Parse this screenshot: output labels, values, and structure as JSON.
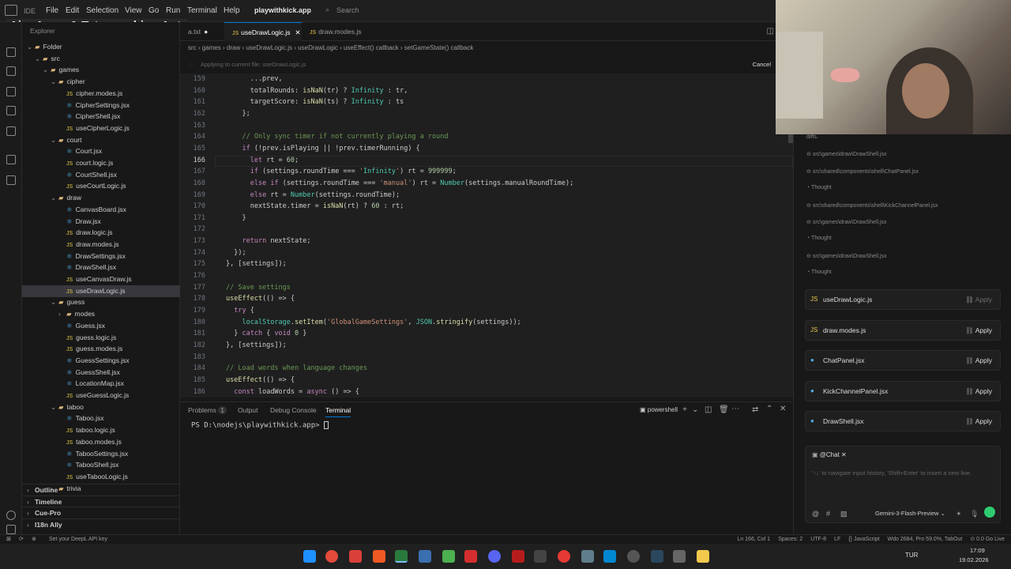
{
  "titlebar": {
    "brand": "IDE",
    "menus": [
      "File",
      "Edit",
      "Selection",
      "View",
      "Go",
      "Run",
      "Terminal",
      "Help"
    ],
    "project": "playwithkick.app",
    "search_placeholder": "Search"
  },
  "overlay_title": "Aira Arere & Tatsunoshin - Apt.",
  "sidebar": {
    "header": "Explorer",
    "tree": [
      {
        "label": "Folder",
        "level": 0,
        "kind": "folder",
        "open": true
      },
      {
        "label": "src",
        "level": 1,
        "kind": "folder",
        "open": true
      },
      {
        "label": "games",
        "level": 2,
        "kind": "folder",
        "open": true
      },
      {
        "label": "cipher",
        "level": 3,
        "kind": "folder",
        "open": true
      },
      {
        "label": "cipher.modes.js",
        "level": 4,
        "kind": "js"
      },
      {
        "label": "CipherSettings.jsx",
        "level": 4,
        "kind": "jsx"
      },
      {
        "label": "CipherShell.jsx",
        "level": 4,
        "kind": "jsx"
      },
      {
        "label": "useCipherLogic.js",
        "level": 4,
        "kind": "js"
      },
      {
        "label": "court",
        "level": 3,
        "kind": "folder",
        "open": true
      },
      {
        "label": "Court.jsx",
        "level": 4,
        "kind": "jsx"
      },
      {
        "label": "court.logic.js",
        "level": 4,
        "kind": "js"
      },
      {
        "label": "CourtShell.jsx",
        "level": 4,
        "kind": "jsx"
      },
      {
        "label": "useCourtLogic.js",
        "level": 4,
        "kind": "js"
      },
      {
        "label": "draw",
        "level": 3,
        "kind": "folder",
        "open": true
      },
      {
        "label": "CanvasBoard.jsx",
        "level": 4,
        "kind": "jsx"
      },
      {
        "label": "Draw.jsx",
        "level": 4,
        "kind": "jsx"
      },
      {
        "label": "draw.logic.js",
        "level": 4,
        "kind": "js"
      },
      {
        "label": "draw.modes.js",
        "level": 4,
        "kind": "js"
      },
      {
        "label": "DrawSettings.jsx",
        "level": 4,
        "kind": "jsx"
      },
      {
        "label": "DrawShell.jsx",
        "level": 4,
        "kind": "jsx"
      },
      {
        "label": "useCanvasDraw.js",
        "level": 4,
        "kind": "js"
      },
      {
        "label": "useDrawLogic.js",
        "level": 4,
        "kind": "js",
        "selected": true
      },
      {
        "label": "guess",
        "level": 3,
        "kind": "folder",
        "open": true
      },
      {
        "label": "modes",
        "level": 4,
        "kind": "folder",
        "open": false
      },
      {
        "label": "Guess.jsx",
        "level": 4,
        "kind": "jsx"
      },
      {
        "label": "guess.logic.js",
        "level": 4,
        "kind": "js"
      },
      {
        "label": "guess.modes.js",
        "level": 4,
        "kind": "js"
      },
      {
        "label": "GuessSettings.jsx",
        "level": 4,
        "kind": "jsx"
      },
      {
        "label": "GuessShell.jsx",
        "level": 4,
        "kind": "jsx"
      },
      {
        "label": "LocationMap.jsx",
        "level": 4,
        "kind": "jsx"
      },
      {
        "label": "useGuessLogic.js",
        "level": 4,
        "kind": "js"
      },
      {
        "label": "taboo",
        "level": 3,
        "kind": "folder",
        "open": true
      },
      {
        "label": "Taboo.jsx",
        "level": 4,
        "kind": "jsx"
      },
      {
        "label": "taboo.logic.js",
        "level": 4,
        "kind": "js"
      },
      {
        "label": "taboo.modes.js",
        "level": 4,
        "kind": "js"
      },
      {
        "label": "TabooSettings.jsx",
        "level": 4,
        "kind": "jsx"
      },
      {
        "label": "TabooShell.jsx",
        "level": 4,
        "kind": "jsx"
      },
      {
        "label": "useTabooLogic.js",
        "level": 4,
        "kind": "js"
      },
      {
        "label": "trivia",
        "level": 3,
        "kind": "folder",
        "open": false
      }
    ],
    "sections": [
      "Outline",
      "Timeline",
      "Cue-Pro",
      "I18n Ally"
    ]
  },
  "tabs": [
    {
      "label": "a.txt",
      "active": false
    },
    {
      "label": "useDrawLogic.js",
      "active": true
    },
    {
      "label": "draw.modes.js",
      "active": false
    }
  ],
  "breadcrumbs": [
    "src",
    "games",
    "draw",
    "useDrawLogic.js",
    "useDrawLogic",
    "useEffect() callback",
    "setGameState() callback"
  ],
  "applybar": {
    "text": "Applying to current file: useDrawLogic.js",
    "cancel": "Cancel"
  },
  "code": {
    "current_line": 166,
    "lines": [
      {
        "n": 159,
        "text": "      ...prev,"
      },
      {
        "n": 160,
        "text": "      totalRounds: isNaN(tr) ? Infinity : tr,"
      },
      {
        "n": 161,
        "text": "      targetScore: isNaN(ts) ? Infinity : ts"
      },
      {
        "n": 162,
        "text": "    };"
      },
      {
        "n": 163,
        "text": ""
      },
      {
        "n": 164,
        "text": "    // Only sync timer if not currently playing a round"
      },
      {
        "n": 165,
        "text": "    if (!prev.isPlaying || !prev.timerRunning) {"
      },
      {
        "n": 166,
        "text": "      let rt = 60;"
      },
      {
        "n": 167,
        "text": "      if (settings.roundTime === 'Infinity') rt = 999999;"
      },
      {
        "n": 168,
        "text": "      else if (settings.roundTime === 'manual') rt = Number(settings.manualRoundTime);"
      },
      {
        "n": 169,
        "text": "      else rt = Number(settings.roundTime);"
      },
      {
        "n": 170,
        "text": "      nextState.timer = isNaN(rt) ? 60 : rt;"
      },
      {
        "n": 171,
        "text": "    }"
      },
      {
        "n": 172,
        "text": ""
      },
      {
        "n": 173,
        "text": "    return nextState;"
      },
      {
        "n": 174,
        "text": "  });"
      },
      {
        "n": 175,
        "text": "}, [settings]);"
      },
      {
        "n": 176,
        "text": ""
      },
      {
        "n": 177,
        "text": "// Save settings"
      },
      {
        "n": 178,
        "text": "useEffect(() => {"
      },
      {
        "n": 179,
        "text": "  try {"
      },
      {
        "n": 180,
        "text": "    localStorage.setItem('GlobalGameSettings', JSON.stringify(settings));"
      },
      {
        "n": 181,
        "text": "  } catch { void 0 }"
      },
      {
        "n": 182,
        "text": "}, [settings]);"
      },
      {
        "n": 183,
        "text": ""
      },
      {
        "n": 184,
        "text": "// Load words when language changes"
      },
      {
        "n": 185,
        "text": "useEffect(() => {"
      },
      {
        "n": 186,
        "text": "  const loadWords = async () => {"
      }
    ]
  },
  "panel": {
    "tabs": [
      "Problems",
      "Output",
      "Debug Console",
      "Terminal"
    ],
    "problems_count": "1",
    "shell": "powershell",
    "prompt": "PS D:\\nodejs\\playwithkick.app> "
  },
  "chat": {
    "items": [
      {
        "text": "diffs.",
        "kind": "text"
      },
      {
        "text": "src\\games\\draw\\DrawShell.jsx",
        "kind": "link"
      },
      {
        "text": "src\\shared\\components\\shell\\ChatPanel.jsx",
        "kind": "link"
      },
      {
        "text": "Thought",
        "kind": "thought"
      },
      {
        "text": "src\\shared\\components\\shell\\KickChannelPanel.jsx",
        "kind": "link"
      },
      {
        "text": "src\\games\\draw\\DrawShell.jsx",
        "kind": "link"
      },
      {
        "text": "Thought",
        "kind": "thought"
      },
      {
        "text": "src\\games\\draw\\DrawShell.jsx",
        "kind": "link"
      },
      {
        "text": "Thought",
        "kind": "thought"
      }
    ],
    "files": [
      {
        "name": "useDrawLogic.js",
        "action": "Apply",
        "icon": "JS"
      },
      {
        "name": "draw.modes.js",
        "action": "Apply",
        "icon": "JS"
      },
      {
        "name": "ChatPanel.jsx",
        "action": "Apply",
        "icon": "●"
      },
      {
        "name": "KickChannelPanel.jsx",
        "action": "Apply",
        "icon": "●"
      },
      {
        "name": "DrawShell.jsx",
        "action": "Apply",
        "icon": "●"
      }
    ],
    "input": {
      "context": "@Chat",
      "placeholder": "'↑↓' to navigate input history, 'Shift+Enter' to insert a new line.",
      "model": "Gemini-3-Flash-Preview"
    }
  },
  "statusbar": {
    "left": "Set your DeepL API key",
    "right": [
      "Ln 166, Col 1",
      "Spaces: 2",
      "UTF-8",
      "LF",
      "{} JavaScript",
      "Wdo 2684, Pro 59.0%, TabOut",
      "⊙ 0.0 Go Live"
    ]
  },
  "taskbar": {
    "lang": "TUR",
    "time": "17:09",
    "date": "19.02.2026"
  }
}
